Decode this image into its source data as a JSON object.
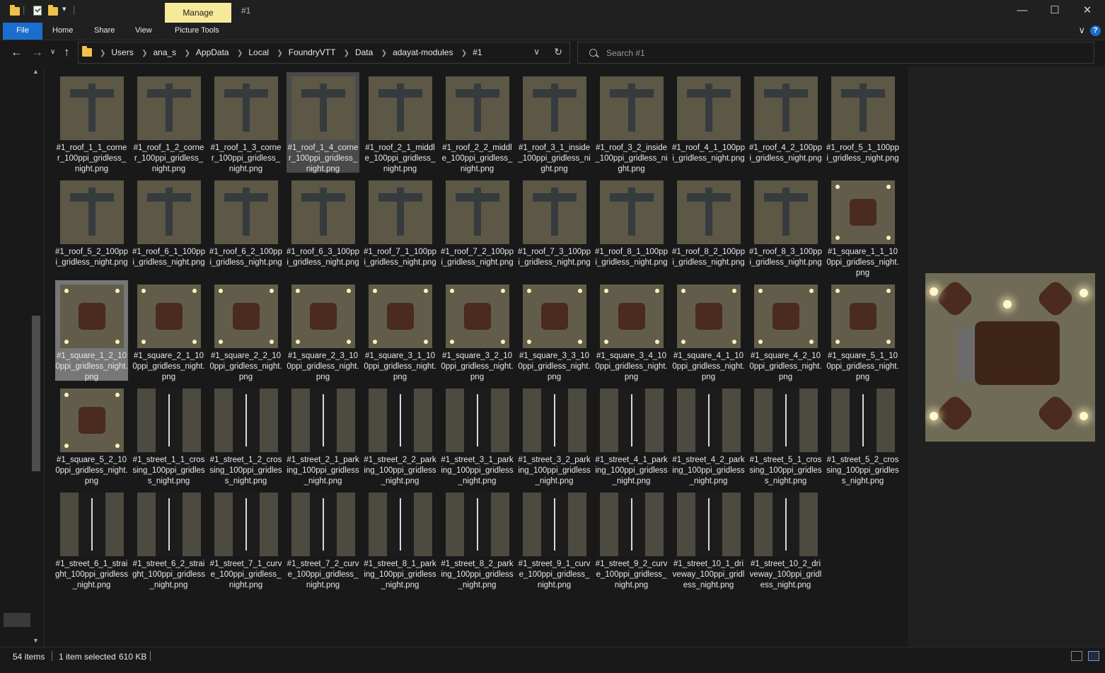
{
  "window": {
    "contextual_tab": "Manage",
    "title": "#1",
    "minimize_glyph": "—",
    "maximize_glyph": "☐",
    "close_glyph": "✕"
  },
  "ribbon": {
    "tabs": [
      "File",
      "Home",
      "Share",
      "View",
      "Picture Tools"
    ],
    "collapse_glyph": "∨",
    "help_glyph": "?"
  },
  "nav": {
    "back_glyph": "←",
    "forward_glyph": "→",
    "recent_glyph": "∨",
    "up_glyph": "↑",
    "dropdown_glyph": "∨",
    "refresh_glyph": "↻"
  },
  "address": {
    "path": [
      "Users",
      "ana_s",
      "AppData",
      "Local",
      "FoundryVTT",
      "Data",
      "adayat-modules",
      "#1"
    ]
  },
  "search": {
    "placeholder": "Search #1"
  },
  "files": [
    {
      "name": "#1_roof_1_1_corner_100ppi_gridless_night.png",
      "kind": "roof"
    },
    {
      "name": "#1_roof_1_2_corner_100ppi_gridless_night.png",
      "kind": "roof"
    },
    {
      "name": "#1_roof_1_3_corner_100ppi_gridless_night.png",
      "kind": "roof"
    },
    {
      "name": "#1_roof_1_4_corner_100ppi_gridless_night.png",
      "kind": "roof"
    },
    {
      "name": "#1_roof_2_1_middle_100ppi_gridless_night.png",
      "kind": "roof"
    },
    {
      "name": "#1_roof_2_2_middle_100ppi_gridless_night.png",
      "kind": "roof"
    },
    {
      "name": "#1_roof_3_1_inside_100ppi_gridless_night.png",
      "kind": "roof"
    },
    {
      "name": "#1_roof_3_2_inside_100ppi_gridless_night.png",
      "kind": "roof"
    },
    {
      "name": "#1_roof_4_1_100ppi_gridless_night.png",
      "kind": "roof"
    },
    {
      "name": "#1_roof_4_2_100ppi_gridless_night.png",
      "kind": "roof"
    },
    {
      "name": "#1_roof_5_1_100ppi_gridless_night.png",
      "kind": "roof"
    },
    {
      "name": "#1_roof_5_2_100ppi_gridless_night.png",
      "kind": "roof"
    },
    {
      "name": "#1_roof_6_1_100ppi_gridless_night.png",
      "kind": "roof"
    },
    {
      "name": "#1_roof_6_2_100ppi_gridless_night.png",
      "kind": "roof"
    },
    {
      "name": "#1_roof_6_3_100ppi_gridless_night.png",
      "kind": "roof"
    },
    {
      "name": "#1_roof_7_1_100ppi_gridless_night.png",
      "kind": "roof"
    },
    {
      "name": "#1_roof_7_2_100ppi_gridless_night.png",
      "kind": "roof"
    },
    {
      "name": "#1_roof_7_3_100ppi_gridless_night.png",
      "kind": "roof"
    },
    {
      "name": "#1_roof_8_1_100ppi_gridless_night.png",
      "kind": "roof"
    },
    {
      "name": "#1_roof_8_2_100ppi_gridless_night.png",
      "kind": "roof"
    },
    {
      "name": "#1_roof_8_3_100ppi_gridless_night.png",
      "kind": "roof"
    },
    {
      "name": "#1_square_1_1_100ppi_gridless_night.png",
      "kind": "square"
    },
    {
      "name": "#1_square_1_2_100ppi_gridless_night.png",
      "kind": "square"
    },
    {
      "name": "#1_square_2_1_100ppi_gridless_night.png",
      "kind": "square"
    },
    {
      "name": "#1_square_2_2_100ppi_gridless_night.png",
      "kind": "square"
    },
    {
      "name": "#1_square_2_3_100ppi_gridless_night.png",
      "kind": "square"
    },
    {
      "name": "#1_square_3_1_100ppi_gridless_night.png",
      "kind": "square"
    },
    {
      "name": "#1_square_3_2_100ppi_gridless_night.png",
      "kind": "square"
    },
    {
      "name": "#1_square_3_3_100ppi_gridless_night.png",
      "kind": "square"
    },
    {
      "name": "#1_square_3_4_100ppi_gridless_night.png",
      "kind": "square"
    },
    {
      "name": "#1_square_4_1_100ppi_gridless_night.png",
      "kind": "square"
    },
    {
      "name": "#1_square_4_2_100ppi_gridless_night.png",
      "kind": "square"
    },
    {
      "name": "#1_square_5_1_100ppi_gridless_night.png",
      "kind": "square"
    },
    {
      "name": "#1_square_5_2_100ppi_gridless_night.png",
      "kind": "square"
    },
    {
      "name": "#1_street_1_1_crossing_100ppi_gridless_night.png",
      "kind": "street"
    },
    {
      "name": "#1_street_1_2_crossing_100ppi_gridless_night.png",
      "kind": "street"
    },
    {
      "name": "#1_street_2_1_parking_100ppi_gridless_night.png",
      "kind": "street"
    },
    {
      "name": "#1_street_2_2_parking_100ppi_gridless_night.png",
      "kind": "street"
    },
    {
      "name": "#1_street_3_1_parking_100ppi_gridless_night.png",
      "kind": "street"
    },
    {
      "name": "#1_street_3_2_parking_100ppi_gridless_night.png",
      "kind": "street"
    },
    {
      "name": "#1_street_4_1_parking_100ppi_gridless_night.png",
      "kind": "street"
    },
    {
      "name": "#1_street_4_2_parking_100ppi_gridless_night.png",
      "kind": "street"
    },
    {
      "name": "#1_street_5_1_crossing_100ppi_gridless_night.png",
      "kind": "street"
    },
    {
      "name": "#1_street_5_2_crossing_100ppi_gridless_night.png",
      "kind": "street"
    },
    {
      "name": "#1_street_6_1_straight_100ppi_gridless_night.png",
      "kind": "street"
    },
    {
      "name": "#1_street_6_2_straight_100ppi_gridless_night.png",
      "kind": "street"
    },
    {
      "name": "#1_street_7_1_curve_100ppi_gridless_night.png",
      "kind": "street"
    },
    {
      "name": "#1_street_7_2_curve_100ppi_gridless_night.png",
      "kind": "street"
    },
    {
      "name": "#1_street_8_1_parking_100ppi_gridless_night.png",
      "kind": "street"
    },
    {
      "name": "#1_street_8_2_parking_100ppi_gridless_night.png",
      "kind": "street"
    },
    {
      "name": "#1_street_9_1_curve_100ppi_gridless_night.png",
      "kind": "street"
    },
    {
      "name": "#1_street_9_2_curve_100ppi_gridless_night.png",
      "kind": "street"
    },
    {
      "name": "#1_street_10_1_driveway_100ppi_gridless_night.png",
      "kind": "street"
    },
    {
      "name": "#1_street_10_2_driveway_100ppi_gridless_night.png",
      "kind": "street"
    }
  ],
  "selected_index": 22,
  "hovered_index": 3,
  "status": {
    "item_count": "54 items",
    "selection": "1 item selected",
    "size": "610 KB"
  }
}
